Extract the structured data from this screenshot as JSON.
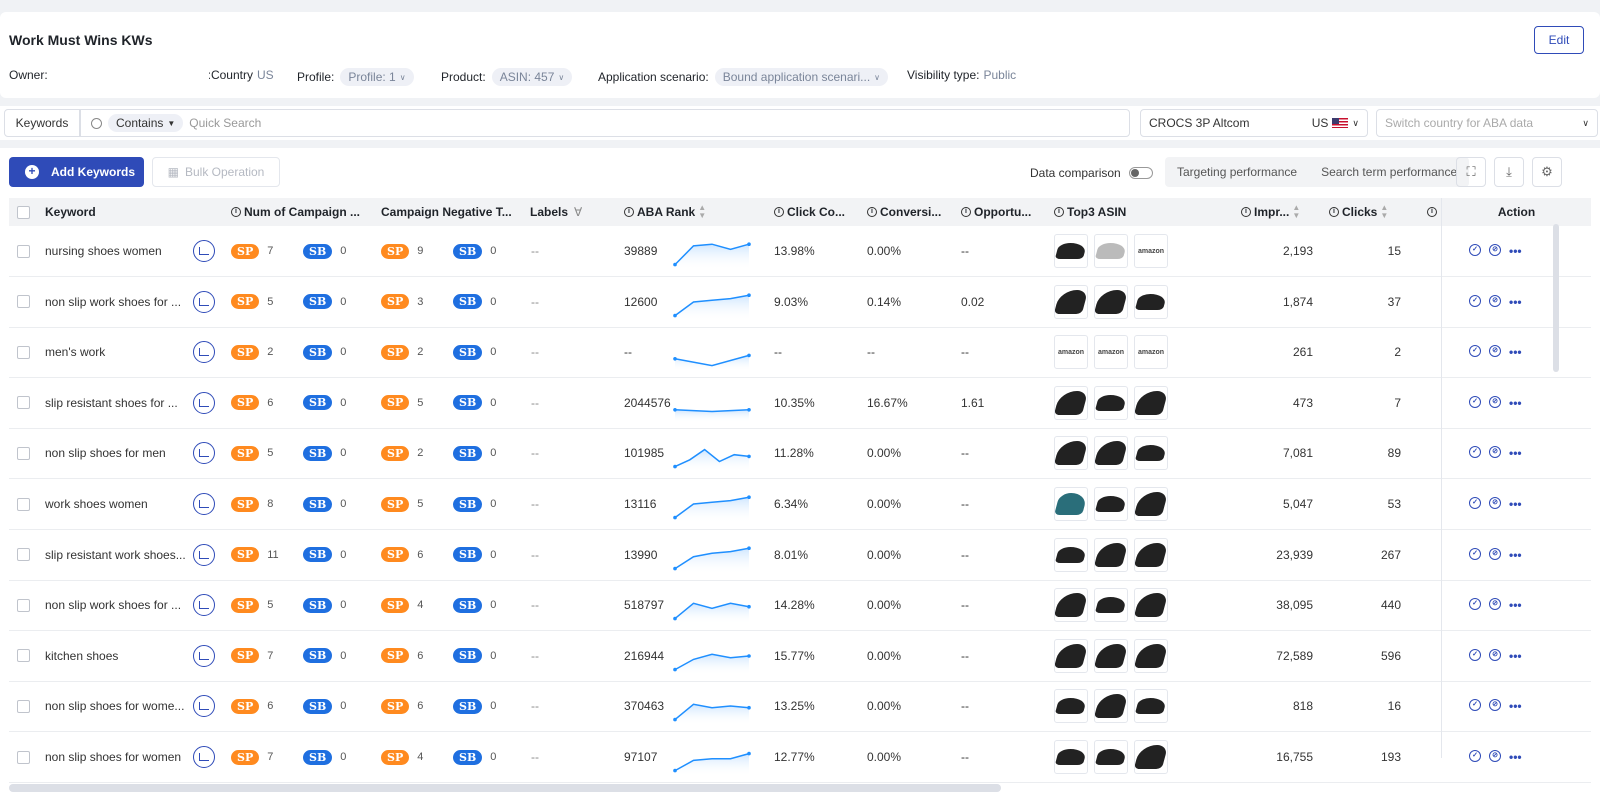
{
  "header": {
    "title": "Work Must Wins KWs",
    "edit_label": "Edit",
    "owner_label": "Owner:",
    "country_label": "Country:",
    "country_value": "US",
    "profile_label": "Profile:",
    "profile_value": "Profile: 1",
    "product_label": "Product:",
    "product_value": "ASIN: 457",
    "scenario_label": "Application scenario:",
    "scenario_value": "Bound application scenari...",
    "visibility_label": "Visibility type:",
    "visibility_value": "Public"
  },
  "filter": {
    "keywords_tab": "Keywords",
    "contains_label": "Contains",
    "search_placeholder": "Quick Search",
    "account": "CROCS 3P Altcom",
    "account_country": "US",
    "aba_placeholder": "Switch country for ABA data"
  },
  "toolbar": {
    "add_label": "Add Keywords",
    "bulk_label": "Bulk Operation",
    "data_comparison": "Data comparison",
    "targeting_tab": "Targeting performance",
    "search_term_tab": "Search term performance"
  },
  "columns": {
    "keyword": "Keyword",
    "campaign": "Num of Campaign ...",
    "negative": "Campaign Negative T...",
    "labels": "Labels",
    "aba_rank": "ABA Rank",
    "click_co": "Click Co...",
    "conversion": "Conversi...",
    "opportunity": "Opportu...",
    "top3": "Top3 ASIN",
    "impr": "Impr...",
    "clicks": "Clicks",
    "action": "Action"
  },
  "pill_labels": {
    "sp": "SP",
    "sb": "SB"
  },
  "rows": [
    {
      "keyword": "nursing shoes women",
      "c_sp": "7",
      "c_sb": "0",
      "n_sp": "9",
      "n_sb": "0",
      "labels": "--",
      "aba": "39889",
      "click": "13.98%",
      "conv": "0.00%",
      "opp": "--",
      "impr": "2,193",
      "clicks": "15",
      "thumbs": [
        "shoe",
        "gray",
        "amazon"
      ],
      "trend": [
        0.9,
        0.35,
        0.3,
        0.45,
        0.3
      ]
    },
    {
      "keyword": "non slip work shoes for ...",
      "c_sp": "5",
      "c_sb": "0",
      "n_sp": "3",
      "n_sb": "0",
      "labels": "--",
      "aba": "12600",
      "click": "9.03%",
      "conv": "0.14%",
      "opp": "0.02",
      "impr": "1,874",
      "clicks": "37",
      "thumbs": [
        "high",
        "high",
        "shoe"
      ],
      "trend": [
        0.9,
        0.5,
        0.45,
        0.4,
        0.3
      ]
    },
    {
      "keyword": "men's work",
      "c_sp": "2",
      "c_sb": "0",
      "n_sp": "2",
      "n_sb": "0",
      "labels": "--",
      "aba": "--",
      "click": "--",
      "conv": "--",
      "opp": "--",
      "impr": "261",
      "clicks": "2",
      "thumbs": [
        "amazon",
        "amazon",
        "amazon"
      ],
      "trend": [
        0.7,
        0.9,
        0.6
      ]
    },
    {
      "keyword": "slip resistant shoes for ...",
      "c_sp": "6",
      "c_sb": "0",
      "n_sp": "5",
      "n_sb": "0",
      "labels": "--",
      "aba": "2044576",
      "click": "10.35%",
      "conv": "16.67%",
      "opp": "1.61",
      "impr": "473",
      "clicks": "7",
      "thumbs": [
        "high",
        "shoe",
        "high"
      ],
      "trend": [
        0.7,
        0.75,
        0.7
      ]
    },
    {
      "keyword": "non slip shoes for men",
      "c_sp": "5",
      "c_sb": "0",
      "n_sp": "2",
      "n_sb": "0",
      "labels": "--",
      "aba": "101985",
      "click": "11.28%",
      "conv": "0.00%",
      "opp": "--",
      "impr": "7,081",
      "clicks": "89",
      "thumbs": [
        "high",
        "high",
        "shoe"
      ],
      "trend": [
        0.9,
        0.7,
        0.4,
        0.75,
        0.55,
        0.6
      ]
    },
    {
      "keyword": "work shoes women",
      "c_sp": "8",
      "c_sb": "0",
      "n_sp": "5",
      "n_sb": "0",
      "labels": "--",
      "aba": "13116",
      "click": "6.34%",
      "conv": "0.00%",
      "opp": "--",
      "impr": "5,047",
      "clicks": "53",
      "thumbs": [
        "teal",
        "shoe",
        "high"
      ],
      "trend": [
        0.9,
        0.5,
        0.45,
        0.4,
        0.3
      ]
    },
    {
      "keyword": "slip resistant work shoes...",
      "c_sp": "11",
      "c_sb": "0",
      "n_sp": "6",
      "n_sb": "0",
      "labels": "--",
      "aba": "13990",
      "click": "8.01%",
      "conv": "0.00%",
      "opp": "--",
      "impr": "23,939",
      "clicks": "267",
      "thumbs": [
        "shoe",
        "high",
        "high"
      ],
      "trend": [
        0.9,
        0.55,
        0.45,
        0.4,
        0.3
      ]
    },
    {
      "keyword": "non slip work shoes for ...",
      "c_sp": "5",
      "c_sb": "0",
      "n_sp": "4",
      "n_sb": "0",
      "labels": "--",
      "aba": "518797",
      "click": "14.28%",
      "conv": "0.00%",
      "opp": "--",
      "impr": "38,095",
      "clicks": "440",
      "thumbs": [
        "high",
        "shoe",
        "high"
      ],
      "trend": [
        0.9,
        0.45,
        0.6,
        0.45,
        0.55
      ]
    },
    {
      "keyword": "kitchen shoes",
      "c_sp": "7",
      "c_sb": "0",
      "n_sp": "6",
      "n_sb": "0",
      "labels": "--",
      "aba": "216944",
      "click": "15.77%",
      "conv": "0.00%",
      "opp": "--",
      "impr": "72,589",
      "clicks": "596",
      "thumbs": [
        "high",
        "high",
        "high"
      ],
      "trend": [
        0.9,
        0.6,
        0.45,
        0.55,
        0.5
      ]
    },
    {
      "keyword": "non slip shoes for wome...",
      "c_sp": "6",
      "c_sb": "0",
      "n_sp": "6",
      "n_sb": "0",
      "labels": "--",
      "aba": "370463",
      "click": "13.25%",
      "conv": "0.00%",
      "opp": "--",
      "impr": "818",
      "clicks": "16",
      "thumbs": [
        "shoe",
        "high",
        "shoe"
      ],
      "trend": [
        0.9,
        0.45,
        0.55,
        0.5,
        0.55
      ]
    },
    {
      "keyword": "non slip shoes for women",
      "c_sp": "7",
      "c_sb": "0",
      "n_sp": "4",
      "n_sb": "0",
      "labels": "--",
      "aba": "97107",
      "click": "12.77%",
      "conv": "0.00%",
      "opp": "--",
      "impr": "16,755",
      "clicks": "193",
      "thumbs": [
        "shoe",
        "shoe",
        "high"
      ],
      "trend": [
        0.9,
        0.6,
        0.55,
        0.55,
        0.4
      ]
    }
  ],
  "colors": {
    "primary": "#2f4bb8",
    "sp": "#ff8a1f",
    "sb": "#1f6fe0",
    "trend": "#1f8fff"
  }
}
